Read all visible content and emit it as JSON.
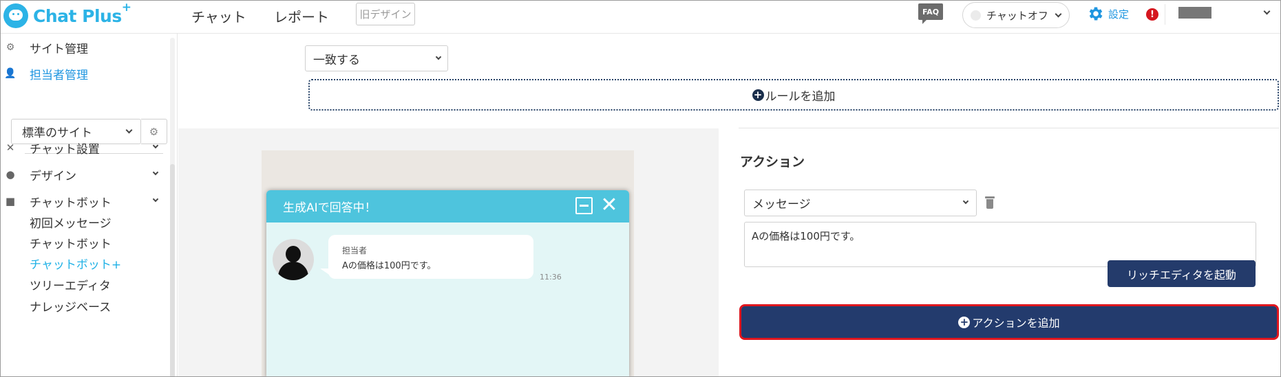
{
  "header": {
    "logo_text": "Chat Plus",
    "logo_plus": "+",
    "nav": [
      "チャット",
      "レポート"
    ],
    "old_design": "旧デザイン",
    "faq": "FAQ",
    "chat_status": "チャットオフ",
    "settings": "設定",
    "alert": "!"
  },
  "sidebar": {
    "top_items": [
      "サイト管理",
      "担当者管理"
    ],
    "site_select": "標準のサイト",
    "menus": [
      "チャット設置",
      "デザイン",
      "チャットボット"
    ],
    "sub_items": [
      "初回メッセージ",
      "チャットボット",
      "チャットボット+",
      "ツリーエディタ",
      "ナレッジベース"
    ]
  },
  "rule": {
    "match_select": "一致する",
    "add_rule": "ルールを追加"
  },
  "preview": {
    "header_title": "生成AIで回答中！",
    "close": "✕",
    "agent_name": "担当者",
    "message": "Aの価格は100円です。",
    "time": "11:36"
  },
  "action": {
    "title": "アクション",
    "type_select": "メッセージ",
    "text_value": "Aの価格は100円です。",
    "rich_editor": "リッチエディタを起動",
    "add_action": "アクションを追加"
  },
  "colors": {
    "brand": "#2cb3e6",
    "accent_blue": "#1f96e0",
    "navy_button": "#233b6d",
    "highlight_red": "#e0161e",
    "chat_header": "#4ec4dd"
  }
}
